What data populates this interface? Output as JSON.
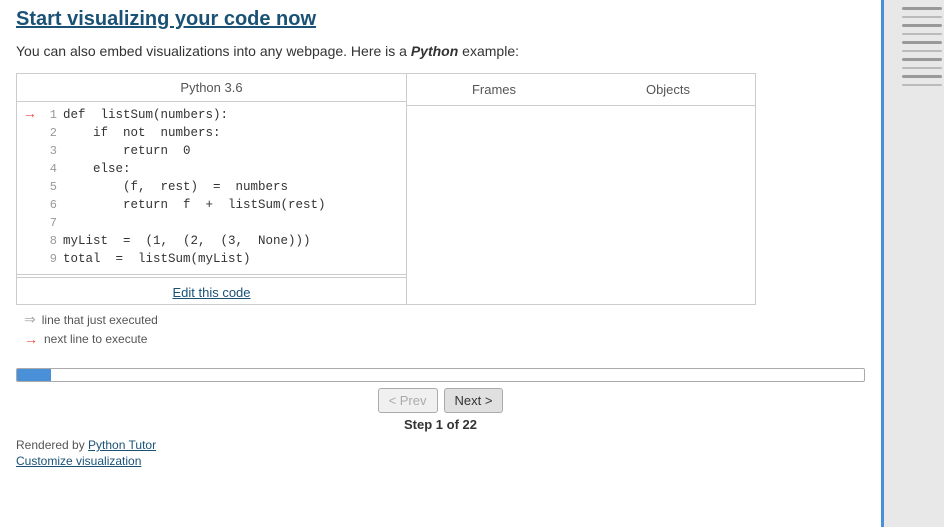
{
  "page": {
    "title": "Start visualizing your code now",
    "intro": "You can also embed visualizations into any webpage. Here is a Python example:",
    "intro_parts": {
      "plain1": "You can also embed visualizations into any webpage. Here is a ",
      "highlight": "Python",
      "plain2": " example:"
    }
  },
  "code_panel": {
    "header": "Python 3.6",
    "lines": [
      {
        "num": "1",
        "arrow": "→",
        "code": "def  listSum(numbers):"
      },
      {
        "num": "2",
        "arrow": "",
        "code": "    if  not  numbers:"
      },
      {
        "num": "3",
        "arrow": "",
        "code": "        return  0"
      },
      {
        "num": "4",
        "arrow": "",
        "code": "    else:"
      },
      {
        "num": "5",
        "arrow": "",
        "code": "        (f,  rest)  =  numbers"
      },
      {
        "num": "6",
        "arrow": "",
        "code": "        return  f  +  listSum(rest)"
      },
      {
        "num": "7",
        "arrow": "",
        "code": ""
      },
      {
        "num": "8",
        "arrow": "",
        "code": "myList  =  (1,  (2,  (3,  None)))"
      },
      {
        "num": "9",
        "arrow": "",
        "code": "total  =  listSum(myList)"
      }
    ],
    "edit_link": "Edit this code"
  },
  "legend": {
    "items": [
      {
        "type": "gray",
        "text": "line that just executed"
      },
      {
        "type": "red",
        "text": "next line to execute"
      }
    ]
  },
  "right_panel": {
    "headers": [
      "Frames",
      "Objects"
    ]
  },
  "controls": {
    "prev_label": "< Prev",
    "next_label": "Next >",
    "step_label": "Step 1 of 22",
    "progress_pct": 4
  },
  "footer": {
    "rendered_by_text": "Rendered by ",
    "rendered_by_link": "Python Tutor",
    "customize_link": "Customize visualization"
  },
  "sidebar": {
    "bars": [
      1,
      2,
      3,
      4,
      5,
      6,
      7,
      8,
      9,
      10
    ]
  }
}
